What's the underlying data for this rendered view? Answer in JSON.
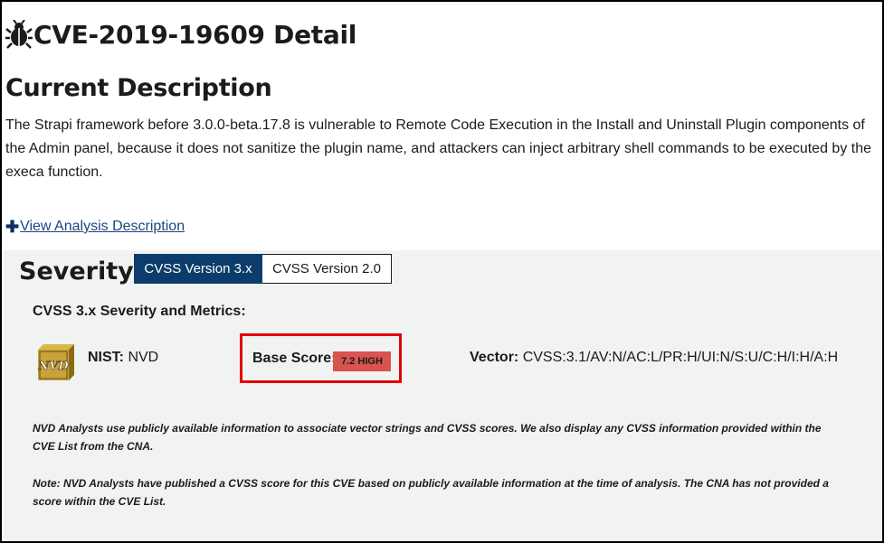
{
  "header": {
    "icon": "bug-icon",
    "title": "CVE-2019-19609 Detail"
  },
  "description": {
    "heading": "Current Description",
    "text": "The Strapi framework before 3.0.0-beta.17.8 is vulnerable to Remote Code Execution in the Install and Uninstall Plugin components of the Admin panel, because it does not sanitize the plugin name, and attackers can inject arbitrary shell commands to be executed by the execa function.",
    "analysis_link": "View Analysis Description",
    "analysis_icon": "plus-icon"
  },
  "severity": {
    "heading": "Severity",
    "tabs": [
      {
        "label": "CVSS Version 3.x",
        "active": true
      },
      {
        "label": "CVSS Version 2.0",
        "active": false
      }
    ],
    "metrics_heading": "CVSS 3.x Severity and Metrics:",
    "source_label": "NIST:",
    "source_value": "NVD",
    "logo_icon": "nvd-logo-icon",
    "logo_text": "NVD",
    "base_score_label": "Base Score:",
    "base_score_badge": "7.2 HIGH",
    "badge_color": "#d9534f",
    "vector_label": "Vector:",
    "vector_value": "CVSS:3.1/AV:N/AC:L/PR:H/UI:N/S:U/C:H/I:H/A:H",
    "note1": "NVD Analysts use publicly available information to associate vector strings and CVSS scores. We also display any CVSS information provided within the CVE List from the CNA.",
    "note2": "Note: NVD Analysts have published a CVSS score for this CVE based on publicly available information at the time of analysis. The CNA has not provided a score within the CVE List."
  },
  "colors": {
    "tab_active": "#0c3c6b",
    "panel_bg": "#f1f3f2",
    "highlight_box": "#e00000",
    "link": "#1a4480"
  }
}
